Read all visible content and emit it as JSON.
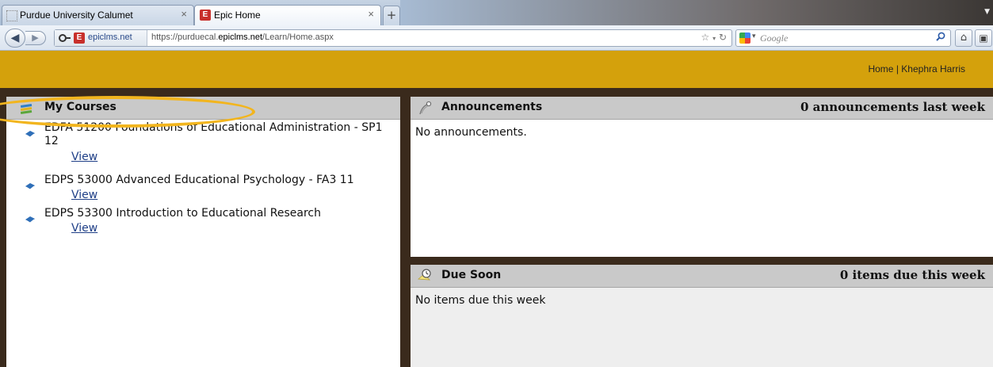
{
  "browser": {
    "tabs": [
      {
        "title": "Purdue University Calumet",
        "active": false
      },
      {
        "title": "Epic Home",
        "active": true
      }
    ],
    "new_tab_glyph": "+",
    "identity_label": "epiclms.net",
    "url_prefix": "https://purduecal.",
    "url_domain": "epiclms.net",
    "url_path": "/Learn/Home.aspx",
    "search_placeholder": "Google",
    "favicon_letter": "E",
    "icons": [
      "back-icon",
      "forward-icon",
      "lock-icon",
      "star-icon",
      "reload-icon",
      "google-icon",
      "search-icon",
      "home-icon",
      "extension-icon"
    ]
  },
  "header": {
    "home_link": "Home",
    "separator": "|",
    "user_name": "Khephra Harris",
    "color": "#d4a10c"
  },
  "courses": {
    "title": "My Courses",
    "items": [
      {
        "name": "EDFA 51200 Foundations of Educational Administration - SP1 12",
        "link": "View"
      },
      {
        "name": "EDPS 53000 Advanced Educational Psychology - FA3 11",
        "link": "View"
      },
      {
        "name": "EDPS 53300 Introduction to Educational Research",
        "link": "View"
      }
    ]
  },
  "announcements": {
    "title": "Announcements",
    "count_text": "0 announcements last week",
    "body": "No announcements."
  },
  "due_soon": {
    "title": "Due Soon",
    "count_text": "0 items due this week",
    "body": "No items due this week"
  },
  "colors": {
    "brand_gold": "#d4a10c",
    "frame_brown": "#3a2a1c",
    "header_gray": "#c9c9c9",
    "annotation_circle": "#f2b51e"
  }
}
